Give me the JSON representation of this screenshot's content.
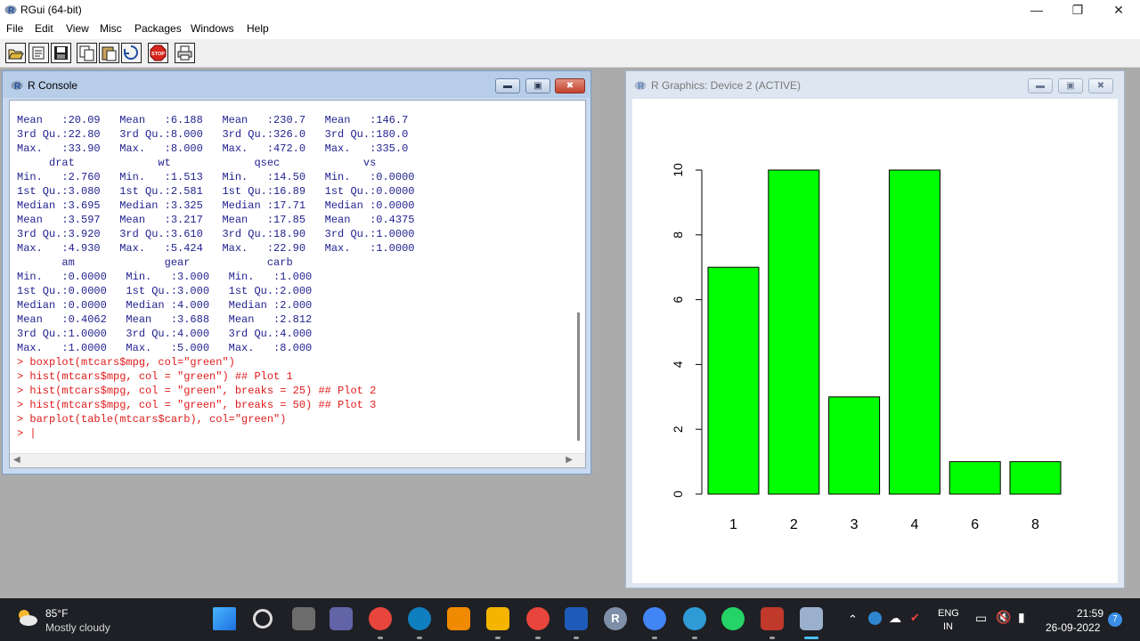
{
  "window": {
    "title": "RGui (64-bit)"
  },
  "menu": [
    "File",
    "Edit",
    "View",
    "Misc",
    "Packages",
    "Windows",
    "Help"
  ],
  "toolbar": {
    "buttons": [
      "open-script-icon",
      "load-workspace-icon",
      "save-icon",
      "copy-icon",
      "paste-icon",
      "copy-paste-icon",
      "stop-icon",
      "print-icon"
    ],
    "stop_label": "STOP"
  },
  "console": {
    "title": "R Console",
    "lines": [
      {
        "text": "Mean   :20.09   Mean   :6.188   Mean   :230.7   Mean   :146.7",
        "kind": "out"
      },
      {
        "text": "3rd Qu.:22.80   3rd Qu.:8.000   3rd Qu.:326.0   3rd Qu.:180.0",
        "kind": "out"
      },
      {
        "text": "Max.   :33.90   Max.   :8.000   Max.   :472.0   Max.   :335.0",
        "kind": "out"
      },
      {
        "text": "     drat             wt             qsec             vs",
        "kind": "out"
      },
      {
        "text": "Min.   :2.760   Min.   :1.513   Min.   :14.50   Min.   :0.0000",
        "kind": "out"
      },
      {
        "text": "1st Qu.:3.080   1st Qu.:2.581   1st Qu.:16.89   1st Qu.:0.0000",
        "kind": "out"
      },
      {
        "text": "Median :3.695   Median :3.325   Median :17.71   Median :0.0000",
        "kind": "out"
      },
      {
        "text": "Mean   :3.597   Mean   :3.217   Mean   :17.85   Mean   :0.4375",
        "kind": "out"
      },
      {
        "text": "3rd Qu.:3.920   3rd Qu.:3.610   3rd Qu.:18.90   3rd Qu.:1.0000",
        "kind": "out"
      },
      {
        "text": "Max.   :4.930   Max.   :5.424   Max.   :22.90   Max.   :1.0000",
        "kind": "out"
      },
      {
        "text": "       am              gear            carb",
        "kind": "out"
      },
      {
        "text": "Min.   :0.0000   Min.   :3.000   Min.   :1.000",
        "kind": "out"
      },
      {
        "text": "1st Qu.:0.0000   1st Qu.:3.000   1st Qu.:2.000",
        "kind": "out"
      },
      {
        "text": "Median :0.0000   Median :4.000   Median :2.000",
        "kind": "out"
      },
      {
        "text": "Mean   :0.4062   Mean   :3.688   Mean   :2.812",
        "kind": "out"
      },
      {
        "text": "3rd Qu.:1.0000   3rd Qu.:4.000   3rd Qu.:4.000",
        "kind": "out"
      },
      {
        "text": "Max.   :1.0000   Max.   :5.000   Max.   :8.000",
        "kind": "out"
      },
      {
        "text": "> boxplot(mtcars$mpg, col=\"green\")",
        "kind": "cmd"
      },
      {
        "text": "> hist(mtcars$mpg, col = \"green\") ## Plot 1",
        "kind": "cmd"
      },
      {
        "text": "> hist(mtcars$mpg, col = \"green\", breaks = 25) ## Plot 2",
        "kind": "cmd"
      },
      {
        "text": "> hist(mtcars$mpg, col = \"green\", breaks = 50) ## Plot 3",
        "kind": "cmd"
      },
      {
        "text": "> barplot(table(mtcars$carb), col=\"green\")",
        "kind": "cmd"
      },
      {
        "text": "> |",
        "kind": "cmd"
      }
    ]
  },
  "graphics": {
    "title": "R Graphics: Device 2 (ACTIVE)"
  },
  "chart_data": {
    "type": "bar",
    "categories": [
      "1",
      "2",
      "3",
      "4",
      "6",
      "8"
    ],
    "values": [
      7,
      10,
      3,
      10,
      1,
      1
    ],
    "ylim": [
      0,
      10
    ],
    "yticks": [
      0,
      2,
      4,
      6,
      8,
      10
    ],
    "bar_color": "#00ff00",
    "bar_border": "#000000",
    "title": "",
    "xlabel": "",
    "ylabel": ""
  },
  "taskbar": {
    "weather_temp": "85°F",
    "weather_desc": "Mostly cloudy",
    "lang_top": "ENG",
    "lang_bottom": "IN",
    "time": "21:59",
    "date": "26-09-2022",
    "notification_count": "7",
    "apps": [
      {
        "name": "start-button",
        "color": "#2b8cff"
      },
      {
        "name": "search-button",
        "color": "#1e2025"
      },
      {
        "name": "task-view-button",
        "color": "#6c6c6c"
      },
      {
        "name": "teams-chat-app",
        "color": "#6264a7"
      },
      {
        "name": "chrome-app",
        "color": "#e8453c"
      },
      {
        "name": "edge-app",
        "color": "#0f7fc0"
      },
      {
        "name": "vlc-app",
        "color": "#f08a00"
      },
      {
        "name": "file-explorer-app",
        "color": "#f4b400"
      },
      {
        "name": "chrome-profile-app",
        "color": "#e8453c"
      },
      {
        "name": "word-app",
        "color": "#1e5bb8"
      },
      {
        "name": "r-app",
        "color": "#7f8fa8"
      },
      {
        "name": "chrome-profile-2-app",
        "color": "#4285f4"
      },
      {
        "name": "telegram-app",
        "color": "#2f9bd6"
      },
      {
        "name": "whatsapp-app",
        "color": "#25d366"
      },
      {
        "name": "snipping-tool-app",
        "color": "#c0392b"
      },
      {
        "name": "rgui-app",
        "color": "#9bb0cc"
      }
    ],
    "r_letter": "R"
  }
}
